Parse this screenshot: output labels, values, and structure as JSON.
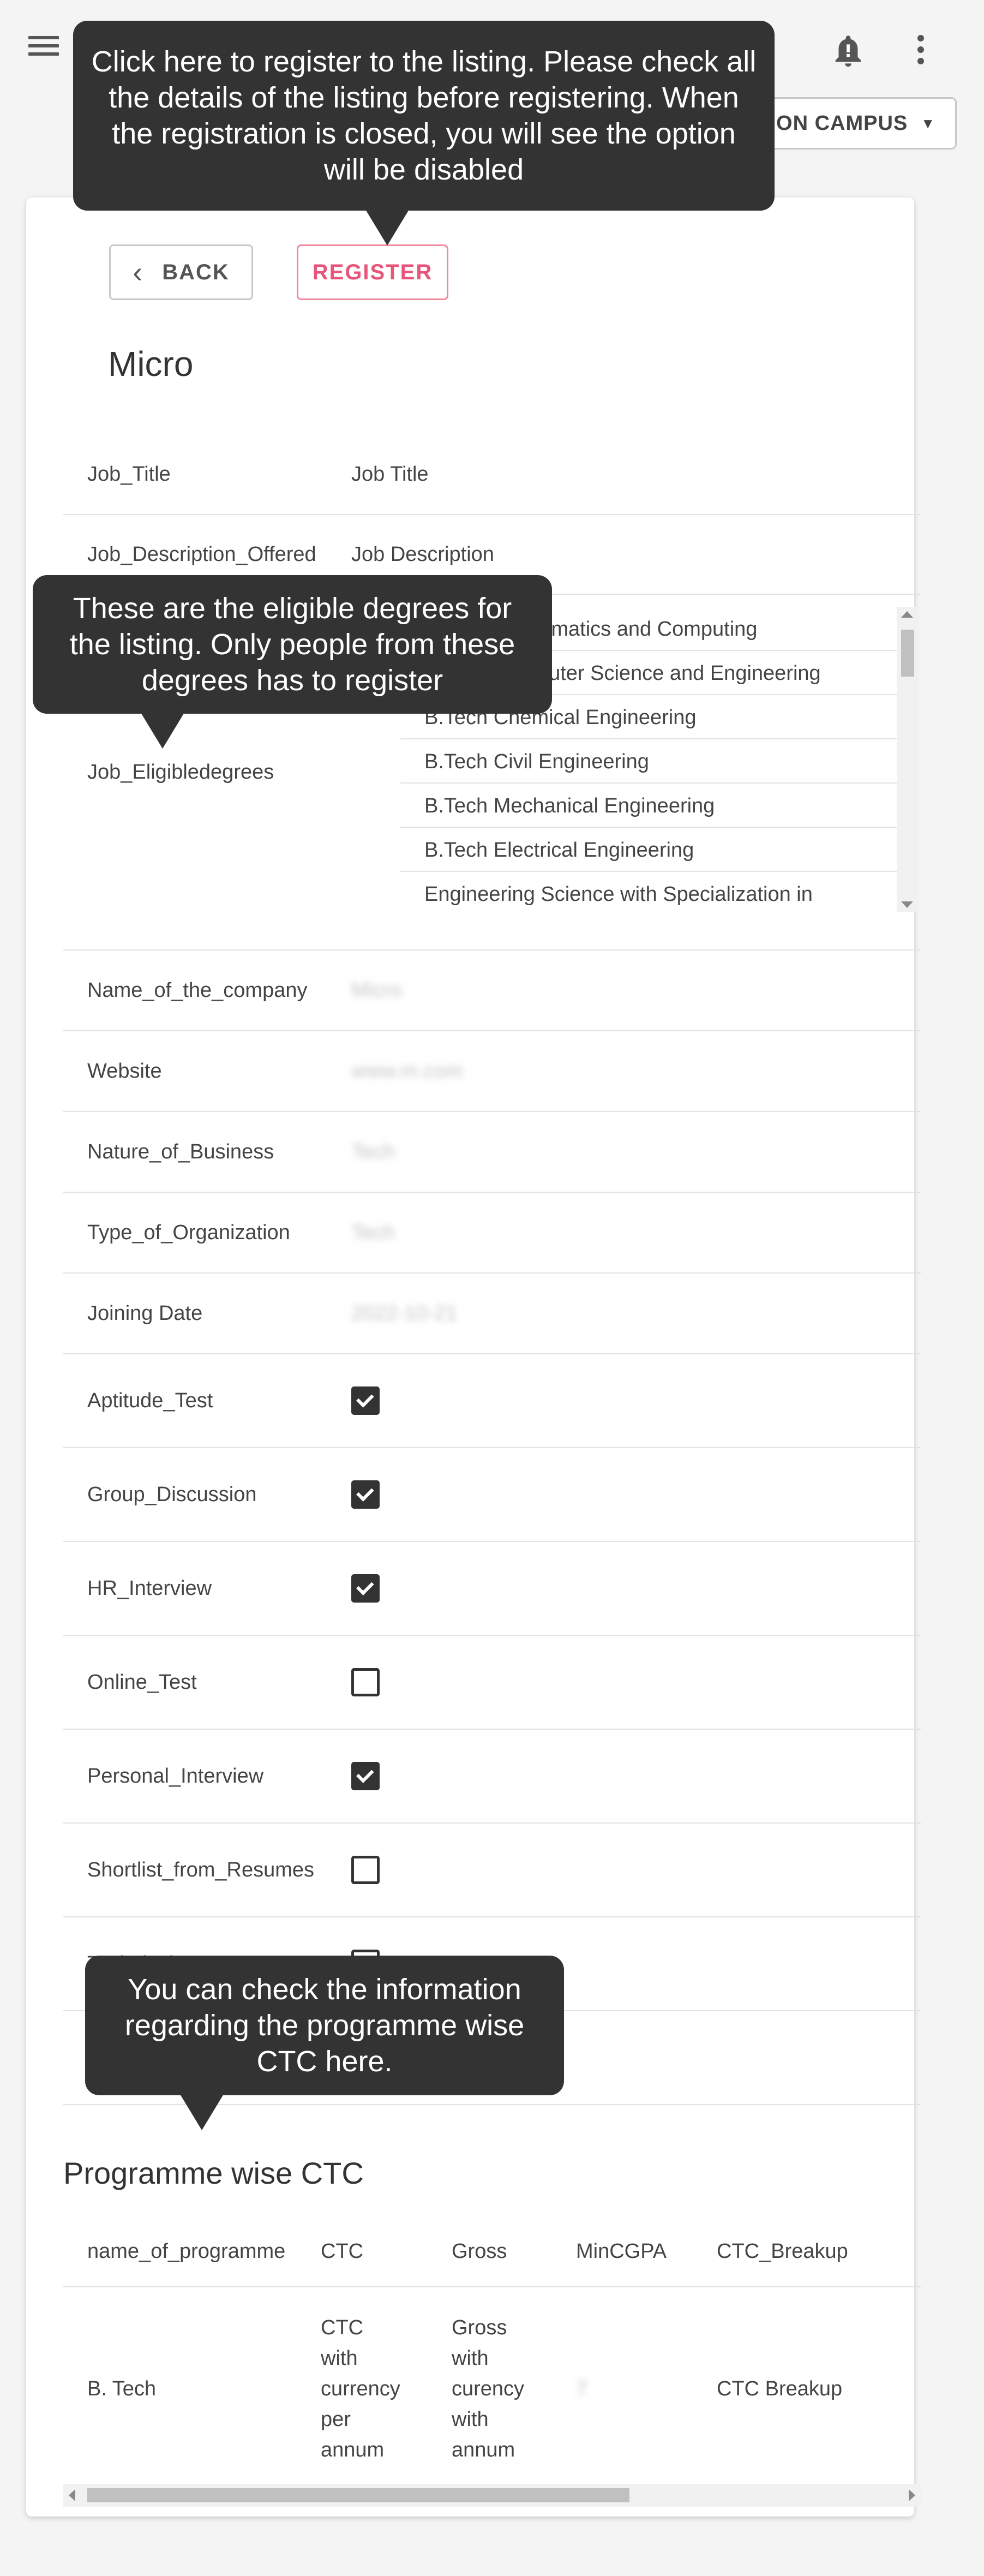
{
  "header": {
    "campus_select": "ON CAMPUS",
    "icons": [
      "menu-icon",
      "bell-icon",
      "more-vert-icon",
      "chevron-down-icon"
    ]
  },
  "actions": {
    "back_label": "BACK",
    "register_label": "REGISTER"
  },
  "listing": {
    "title": "Micro",
    "fields": [
      {
        "label": "Job_Title",
        "value": "Job Title"
      },
      {
        "label": "Job_Description_Offered",
        "value": "Job Description"
      }
    ],
    "eligible_label": "Job_Eligibledegrees",
    "eligible_degrees": [
      "B.Tech Mathematics and Computing",
      "B.Tech Computer Science and Engineering",
      "B.Tech Chemical Engineering",
      "B.Tech Civil Engineering",
      "B.Tech Mechanical Engineering",
      "B.Tech Electrical Engineering",
      "Engineering Science with Specialization in"
    ],
    "company_fields": [
      {
        "label": "Name_of_the_company",
        "value": "Micro"
      },
      {
        "label": "Website",
        "value": "www.m.com"
      },
      {
        "label": "Nature_of_Business",
        "value": "Tech"
      },
      {
        "label": "Type_of_Organization",
        "value": "Tech"
      },
      {
        "label": "Joining Date",
        "value": "2022-10-21"
      }
    ],
    "selection_process": [
      {
        "label": "Aptitude_Test",
        "checked": true
      },
      {
        "label": "Group_Discussion",
        "checked": true
      },
      {
        "label": "HR_Interview",
        "checked": true
      },
      {
        "label": "Online_Test",
        "checked": false
      },
      {
        "label": "Personal_Interview",
        "checked": true
      },
      {
        "label": "Shortlist_from_Resumes",
        "checked": false
      },
      {
        "label": "Technical_Test",
        "checked": false
      },
      {
        "label": "",
        "checked": false
      }
    ]
  },
  "ctc": {
    "section_title": "Programme wise CTC",
    "headers": [
      "name_of_programme",
      "CTC",
      "Gross",
      "MinCGPA",
      "CTC_Breakup"
    ],
    "rows": [
      {
        "programme": "B. Tech",
        "ctc": "CTC\nwith\ncurrency\nper\nannum",
        "gross": "Gross\nwith\ncurency\nwith\nannum",
        "min_cgpa": "7",
        "breakup": "CTC Breakup"
      }
    ]
  },
  "tooltips": {
    "register": "Click here to register to the listing. Please check all the details of the listing before registering. When the registration is closed, you will see the option will be disabled",
    "degrees": "These are the eligible degrees for the listing. Only people from these degrees has to register",
    "ctc": "You can check the information regarding the programme wise CTC here."
  }
}
